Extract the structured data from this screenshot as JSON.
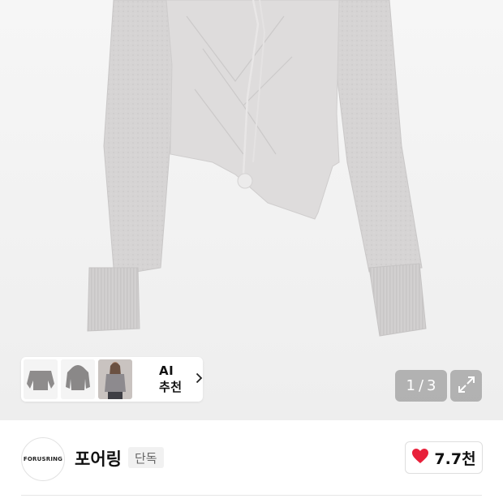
{
  "gallery": {
    "page_current": "1",
    "page_separator": "/",
    "page_total": "3",
    "thumbnails": [
      {
        "name": "thumb-sweater-front"
      },
      {
        "name": "thumb-sweater-hood"
      },
      {
        "name": "thumb-model"
      }
    ],
    "ai_link_label": "AI 추천",
    "expand_icon": "expand-icon"
  },
  "brand": {
    "logo_text": "FORUSRING",
    "name": "포어링",
    "badge": "단독",
    "like_count": "7.7천",
    "like_icon_color": "#e8203a"
  }
}
